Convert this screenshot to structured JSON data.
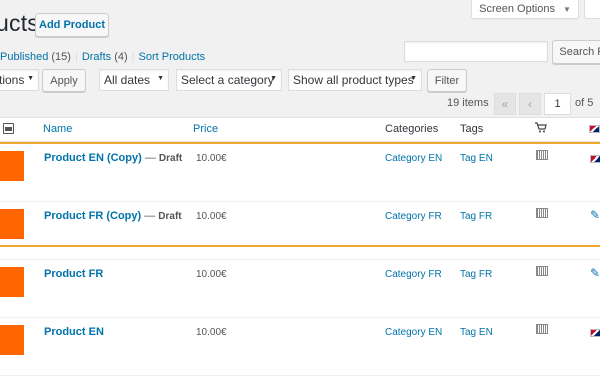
{
  "header": {
    "title": "ucts",
    "add_button": "Add Product",
    "screen_options": "Screen Options"
  },
  "views": {
    "published_label": "Published",
    "published_count": "(15)",
    "drafts_label": "Drafts",
    "drafts_count": "(4)",
    "sort_label": "Sort Products",
    "separator": "|"
  },
  "search": {
    "button": "Search P",
    "placeholder": ""
  },
  "filters": {
    "bulk_action": "tions",
    "apply": "Apply",
    "dates": "All dates",
    "category": "Select a category",
    "product_type": "Show all product types",
    "filter": "Filter"
  },
  "pagination": {
    "items": "19 items",
    "first": "«",
    "prev": "‹",
    "current": "1",
    "of": "of 5"
  },
  "table": {
    "columns": {
      "name": "Name",
      "price": "Price",
      "categories": "Categories",
      "tags": "Tags"
    },
    "rows": [
      {
        "name": "Product EN (Copy)",
        "state": "Draft",
        "price": "10.00€",
        "category": "Category EN",
        "tag": "Tag EN",
        "lang_icon": "flag-icon"
      },
      {
        "name": "Product FR (Copy)",
        "state": "Draft",
        "price": "10.00€",
        "category": "Category FR",
        "tag": "Tag FR",
        "lang_icon": "pencil-icon"
      },
      {
        "name": "Product FR",
        "state": "",
        "price": "10.00€",
        "category": "Category FR",
        "tag": "Tag FR",
        "lang_icon": "pencil-icon"
      },
      {
        "name": "Product EN",
        "state": "",
        "price": "10.00€",
        "category": "Category EN",
        "tag": "Tag EN",
        "lang_icon": "flag-icon"
      }
    ]
  },
  "colors": {
    "link": "#0073aa",
    "thumbnail": "#ff6600",
    "highlight_line": "#f0a830"
  }
}
